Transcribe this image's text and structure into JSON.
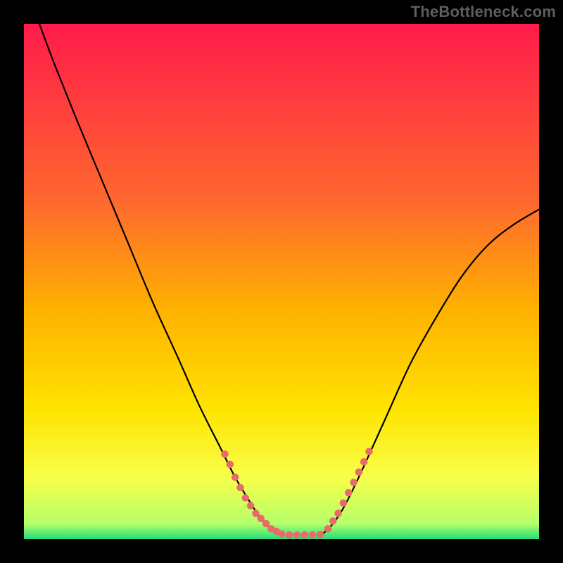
{
  "watermark": "TheBottleneck.com",
  "chart_data": {
    "type": "line",
    "title": "",
    "xlabel": "",
    "ylabel": "",
    "xlim": [
      0,
      100
    ],
    "ylim": [
      0,
      100
    ],
    "grid": false,
    "legend": false,
    "background_gradient": {
      "stops": [
        {
          "offset": 0,
          "color": "#ff1a4b"
        },
        {
          "offset": 35,
          "color": "#ff6a2d"
        },
        {
          "offset": 55,
          "color": "#ffb000"
        },
        {
          "offset": 75,
          "color": "#ffe400"
        },
        {
          "offset": 88,
          "color": "#f8ff4a"
        },
        {
          "offset": 97,
          "color": "#b6ff6a"
        },
        {
          "offset": 100,
          "color": "#22e07a"
        }
      ]
    },
    "series": [
      {
        "name": "left-curve",
        "x": [
          3,
          6,
          10,
          15,
          20,
          25,
          30,
          34,
          38,
          41,
          44,
          46,
          48,
          50
        ],
        "y": [
          100,
          92,
          82,
          70,
          58,
          46,
          35,
          26,
          18,
          12,
          7,
          4,
          2,
          1
        ],
        "stroke": "#000000",
        "width": 2
      },
      {
        "name": "right-curve",
        "x": [
          58,
          60,
          62,
          65,
          70,
          75,
          80,
          85,
          90,
          95,
          100
        ],
        "y": [
          1,
          3,
          6,
          12,
          23,
          34,
          43,
          51,
          57,
          61,
          64
        ],
        "stroke": "#000000",
        "width": 2
      }
    ],
    "marker_groups": [
      {
        "name": "left-highlight-dots",
        "color": "#e96a6a",
        "radius": 5.5,
        "points": [
          {
            "x": 39,
            "y": 16.5
          },
          {
            "x": 40,
            "y": 14.5
          },
          {
            "x": 41,
            "y": 12
          },
          {
            "x": 42,
            "y": 10
          },
          {
            "x": 43,
            "y": 8
          },
          {
            "x": 44,
            "y": 6.5
          },
          {
            "x": 45,
            "y": 5
          },
          {
            "x": 46,
            "y": 4
          },
          {
            "x": 47,
            "y": 3
          },
          {
            "x": 48,
            "y": 2
          },
          {
            "x": 49,
            "y": 1.5
          }
        ]
      },
      {
        "name": "valley-dots",
        "color": "#e96a6a",
        "radius": 5.5,
        "points": [
          {
            "x": 50,
            "y": 1
          },
          {
            "x": 51.5,
            "y": 0.8
          },
          {
            "x": 53,
            "y": 0.8
          },
          {
            "x": 54.5,
            "y": 0.8
          },
          {
            "x": 56,
            "y": 0.8
          },
          {
            "x": 57.5,
            "y": 0.9
          }
        ]
      },
      {
        "name": "right-highlight-dots",
        "color": "#e96a6a",
        "radius": 5.5,
        "points": [
          {
            "x": 59,
            "y": 2
          },
          {
            "x": 60,
            "y": 3.5
          },
          {
            "x": 61,
            "y": 5
          },
          {
            "x": 62,
            "y": 7
          },
          {
            "x": 63,
            "y": 9
          },
          {
            "x": 64,
            "y": 11
          },
          {
            "x": 65,
            "y": 13
          },
          {
            "x": 66,
            "y": 15
          },
          {
            "x": 67,
            "y": 17
          }
        ]
      }
    ]
  }
}
